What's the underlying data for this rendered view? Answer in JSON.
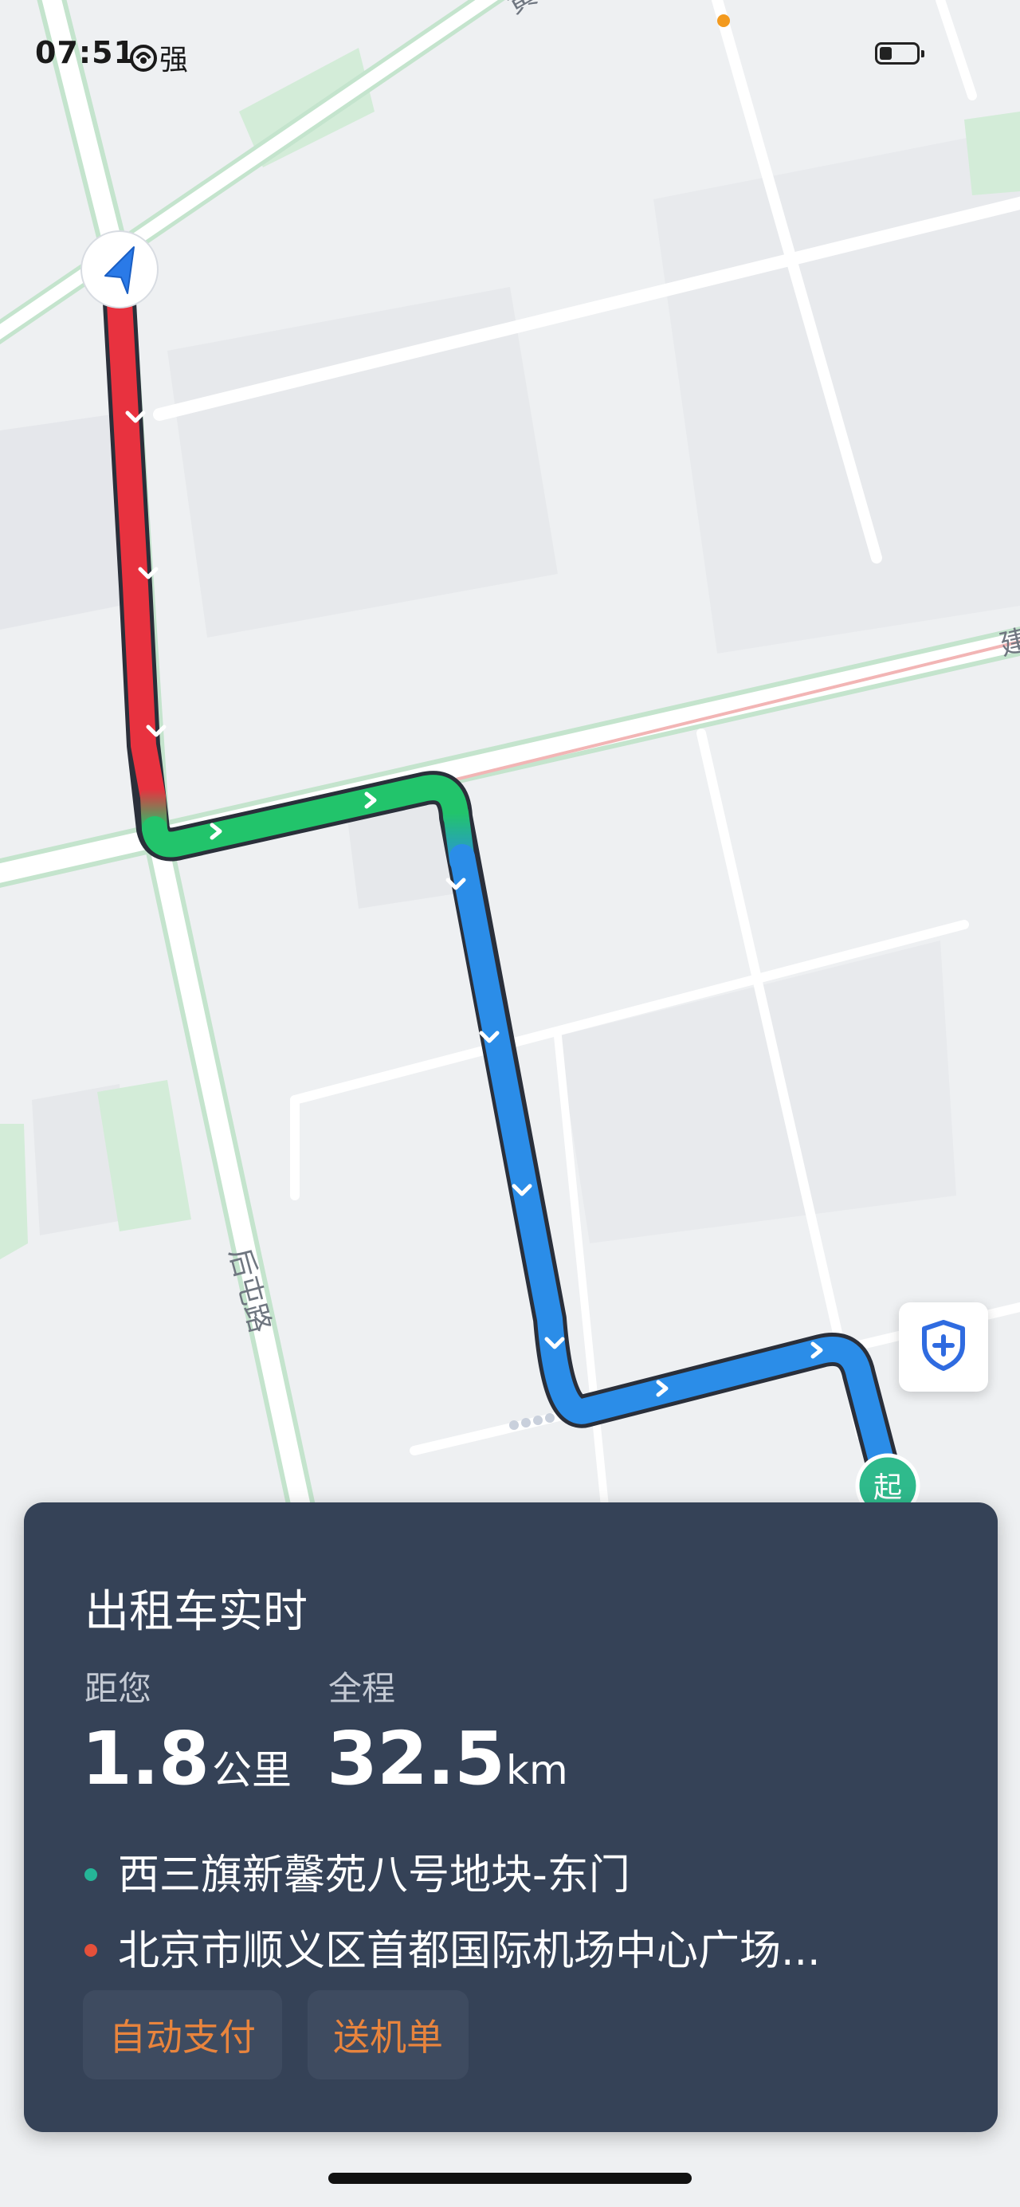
{
  "status_bar": {
    "time": "07:51",
    "signal_label": "强",
    "signal_icon": "hotspot-icon",
    "battery_level": 0.35,
    "notification_dot_color": "#f39a1e"
  },
  "map": {
    "road_label": "后屯路",
    "top_road_fragment": "黄",
    "right_road_fragment": "建",
    "start_marker_label": "起",
    "route_colors": {
      "congested": "#e8323f",
      "smooth": "#22c46b",
      "normal": "#2b8de8"
    },
    "navigation_arrow_icon": "navigation-arrow-icon",
    "safety_button_icon": "shield-plus-icon"
  },
  "card": {
    "title": "出租车实时",
    "distance_label": "距您",
    "distance_value": "1.8",
    "distance_unit": "公里",
    "total_label": "全程",
    "total_value": "32.5",
    "total_unit": "km",
    "from_address": "西三旗新馨苑八号地块-东门",
    "to_address": "北京市顺义区首都国际机场中心广场...",
    "from_dot_color": "#25b597",
    "to_dot_color": "#e5503a",
    "buttons": {
      "auto_pay": "自动支付",
      "airport_order": "送机单"
    }
  }
}
